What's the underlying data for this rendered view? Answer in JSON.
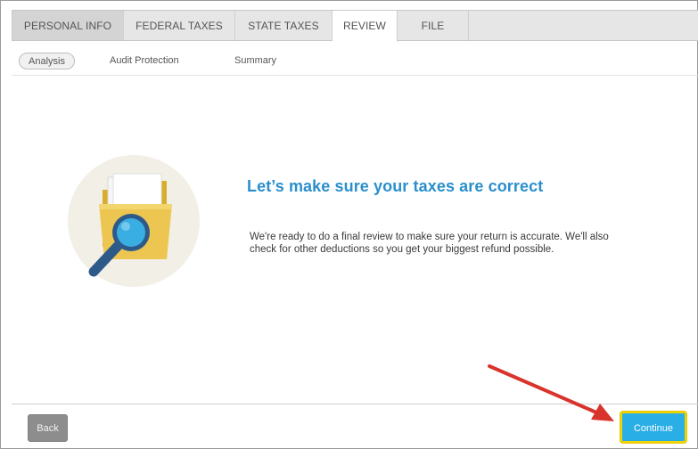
{
  "tabs": [
    {
      "label": "PERSONAL INFO"
    },
    {
      "label": "FEDERAL TAXES"
    },
    {
      "label": "STATE TAXES"
    },
    {
      "label": "REVIEW"
    },
    {
      "label": "FILE"
    }
  ],
  "subtabs": [
    {
      "label": "Analysis"
    },
    {
      "label": "Audit Protection"
    },
    {
      "label": "Summary"
    }
  ],
  "main": {
    "headline": "Let’s make sure your taxes are correct",
    "body": "We're ready to do a final review to make sure your return is accurate. We'll also check for other deductions so you get your biggest refund possible.",
    "illustration_icon": "folder-magnifier-icon"
  },
  "footer": {
    "back_label": "Back",
    "continue_label": "Continue"
  },
  "colors": {
    "accent": "#2a8fcc",
    "continue_button": "#2aaee6",
    "highlight_outline": "#f0d400",
    "annotation_arrow": "#d9342b"
  }
}
